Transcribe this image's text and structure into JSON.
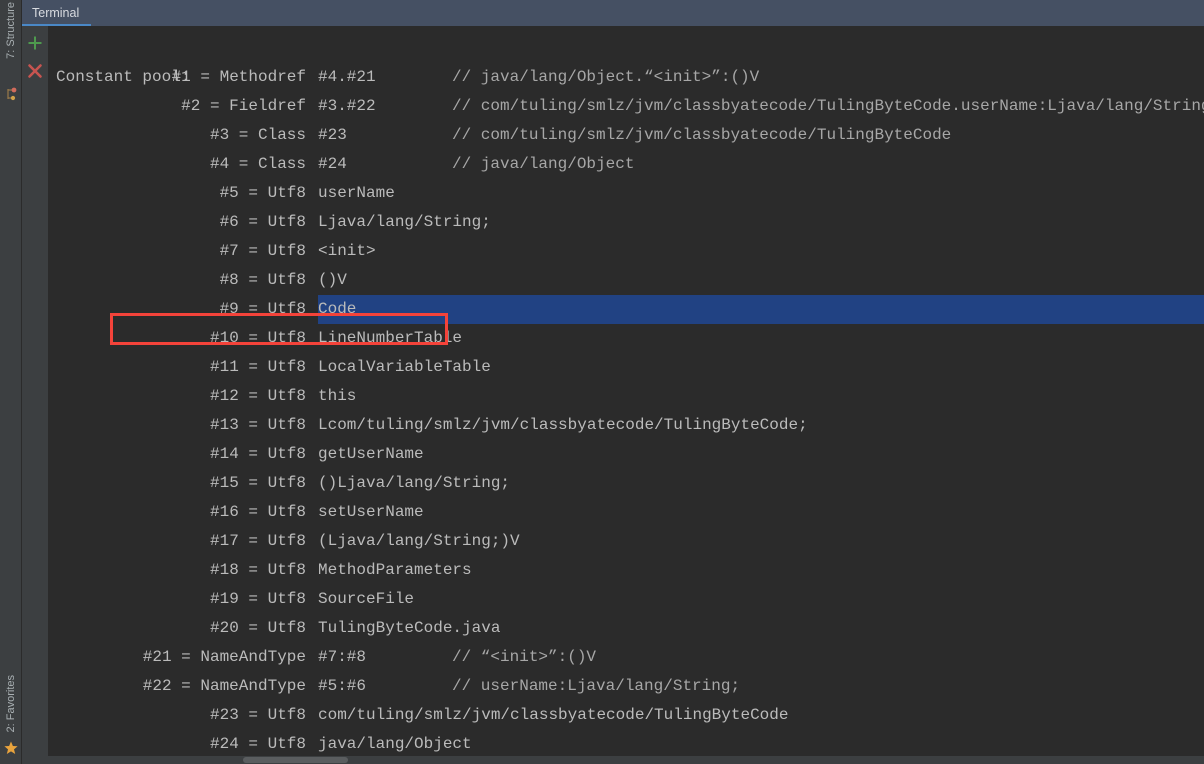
{
  "window": {
    "tool_window_title": "Terminal"
  },
  "sidebar": {
    "tabs": [
      {
        "label": "7: Structure",
        "icon": "structure-icon"
      },
      {
        "label": "2: Favorites",
        "icon": "star-icon"
      }
    ]
  },
  "toolbar": {
    "buttons": [
      {
        "name": "new-session-button",
        "icon": "plus-icon",
        "label": "+",
        "color": "#4e9a4e"
      },
      {
        "name": "close-session-button",
        "icon": "close-icon",
        "label": "×",
        "color": "#c75450"
      }
    ]
  },
  "colors": {
    "terminal_background": "#2b2b2b",
    "header_background": "#455063",
    "toolbar_background": "#3c3f41",
    "text": "#bbbbbb",
    "selection": "#214283",
    "annotation": "#f4433a",
    "tab_underline": "#4a88c7"
  },
  "terminal": {
    "header_line": "Constant pool:",
    "entries": [
      {
        "index": "#1 = Methodref",
        "value": "#4.#21",
        "comment": "// java/lang/Object.“<init>”:()V"
      },
      {
        "index": "#2 = Fieldref",
        "value": "#3.#22",
        "comment": "// com/tuling/smlz/jvm/classbyatecode/TulingByteCode.userName:Ljava/lang/String;"
      },
      {
        "index": "#3 = Class",
        "value": "#23",
        "comment": "// com/tuling/smlz/jvm/classbyatecode/TulingByteCode"
      },
      {
        "index": "#4 = Class",
        "value": "#24",
        "comment": "// java/lang/Object"
      },
      {
        "index": "#5 = Utf8",
        "value": "userName",
        "comment": ""
      },
      {
        "index": "#6 = Utf8",
        "value": "Ljava/lang/String;",
        "comment": ""
      },
      {
        "index": "#7 = Utf8",
        "value": "<init>",
        "comment": ""
      },
      {
        "index": "#8 = Utf8",
        "value": "()V",
        "comment": ""
      },
      {
        "index": "#9 = Utf8",
        "value": "Code",
        "comment": "",
        "selected": true,
        "annotated": true
      },
      {
        "index": "#10 = Utf8",
        "value": "LineNumberTable",
        "comment": ""
      },
      {
        "index": "#11 = Utf8",
        "value": "LocalVariableTable",
        "comment": ""
      },
      {
        "index": "#12 = Utf8",
        "value": "this",
        "comment": ""
      },
      {
        "index": "#13 = Utf8",
        "value": "Lcom/tuling/smlz/jvm/classbyatecode/TulingByteCode;",
        "comment": ""
      },
      {
        "index": "#14 = Utf8",
        "value": "getUserName",
        "comment": ""
      },
      {
        "index": "#15 = Utf8",
        "value": "()Ljava/lang/String;",
        "comment": ""
      },
      {
        "index": "#16 = Utf8",
        "value": "setUserName",
        "comment": ""
      },
      {
        "index": "#17 = Utf8",
        "value": "(Ljava/lang/String;)V",
        "comment": ""
      },
      {
        "index": "#18 = Utf8",
        "value": "MethodParameters",
        "comment": ""
      },
      {
        "index": "#19 = Utf8",
        "value": "SourceFile",
        "comment": ""
      },
      {
        "index": "#20 = Utf8",
        "value": "TulingByteCode.java",
        "comment": ""
      },
      {
        "index": "#21 = NameAndType",
        "value": "#7:#8",
        "comment": "// “<init>”:()V"
      },
      {
        "index": "#22 = NameAndType",
        "value": "#5:#6",
        "comment": "// userName:Ljava/lang/String;"
      },
      {
        "index": "#23 = Utf8",
        "value": "com/tuling/smlz/jvm/classbyatecode/TulingByteCode",
        "comment": ""
      },
      {
        "index": "#24 = Utf8",
        "value": "java/lang/Object",
        "comment": ""
      }
    ]
  }
}
